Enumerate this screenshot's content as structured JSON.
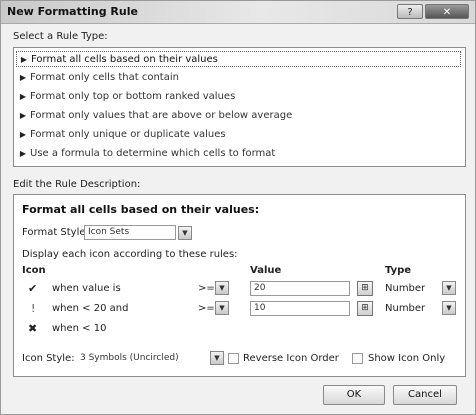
{
  "window": {
    "title": "New Formatting Rule",
    "help_label": "?",
    "close_label": "✕"
  },
  "select_rule": {
    "label": "Select a Rule Type:",
    "items": [
      "Format all cells based on their values",
      "Format only cells that contain",
      "Format only top or bottom ranked values",
      "Format only values that are above or below average",
      "Format only unique or duplicate values",
      "Use a formula to determine which cells to format"
    ],
    "selected_index": 0
  },
  "edit_rule": {
    "label": "Edit the Rule Description:",
    "heading": "Format all cells based on their values:",
    "format_style_label": "Format Style:",
    "format_style_value": "Icon Sets",
    "display_text": "Display each icon according to these rules:",
    "columns": {
      "icon": "Icon",
      "value": "Value",
      "type": "Type"
    },
    "rows": [
      {
        "icon": "check-mark-icon",
        "condition": "when value is",
        "operator": ">=",
        "value": "20",
        "type": "Number"
      },
      {
        "icon": "exclamation-icon",
        "condition": "when < 20 and",
        "operator": ">=",
        "value": "10",
        "type": "Number"
      },
      {
        "icon": "x-mark-icon",
        "condition": "when < 10"
      }
    ],
    "icon_style_label": "Icon Style:",
    "icon_style_value": "3 Symbols (Uncircled)",
    "reverse_label": "Reverse Icon Order",
    "show_icon_only_label": "Show Icon Only"
  },
  "buttons": {
    "ok": "OK",
    "cancel": "Cancel"
  }
}
